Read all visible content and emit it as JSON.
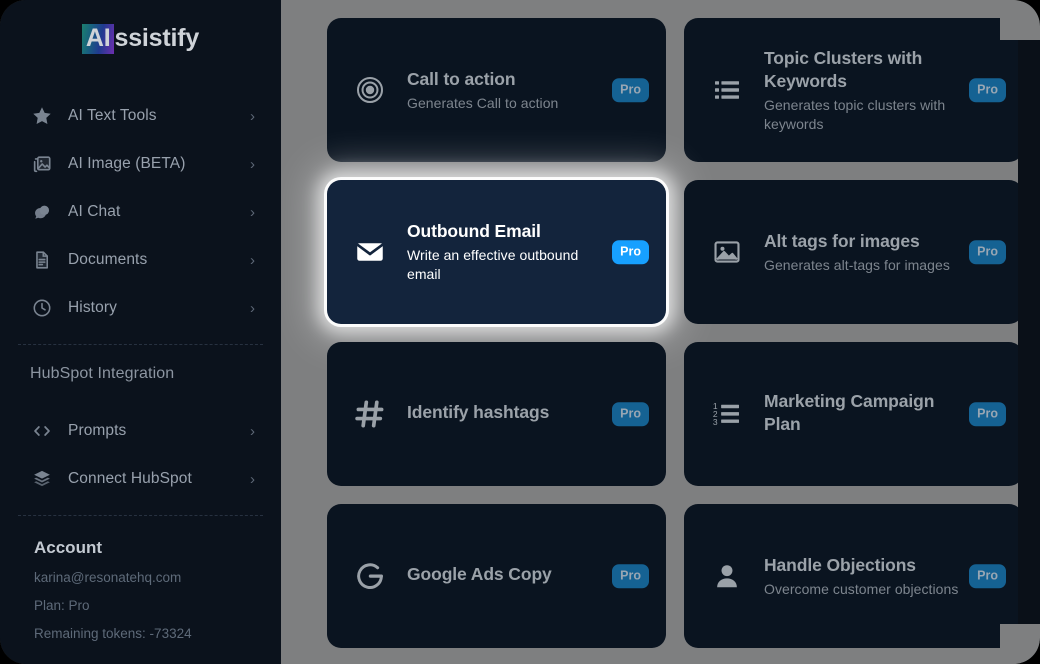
{
  "brand": {
    "logo_accent": "AI",
    "logo_rest": "ssistify",
    "gradient_from": "#1c7f6e",
    "gradient_to": "#6d2fb0"
  },
  "sidebar": {
    "nav_items": [
      {
        "label": "AI Text Tools",
        "icon": "star-icon",
        "chevron": "›"
      },
      {
        "label": "AI Image (BETA)",
        "icon": "image-stack-icon",
        "chevron": "›"
      },
      {
        "label": "AI Chat",
        "icon": "chat-bubble-icon",
        "chevron": "›"
      },
      {
        "label": "Documents",
        "icon": "document-icon",
        "chevron": "›"
      },
      {
        "label": "History",
        "icon": "clock-icon",
        "chevron": "›"
      }
    ],
    "integration_title": "HubSpot Integration",
    "integration_items": [
      {
        "label": "Prompts",
        "icon": "code-brackets-icon",
        "chevron": "›"
      },
      {
        "label": "Connect HubSpot",
        "icon": "layers-icon",
        "chevron": "›"
      }
    ],
    "account_title": "Account",
    "account_email": "karina@resonatehq.com",
    "account_plan": "Plan: Pro",
    "account_tokens": "Remaining tokens: -73324"
  },
  "main": {
    "badge_label": "Pro",
    "cards": [
      {
        "title": "Call to action",
        "desc": "Generates Call to action",
        "icon": "target-icon",
        "selected": false
      },
      {
        "title": "Topic Clusters with Keywords",
        "desc": "Generates topic clusters with keywords",
        "icon": "bullet-list-icon",
        "selected": false
      },
      {
        "title": "Outbound Email",
        "desc": "Write an effective outbound email",
        "icon": "envelope-icon",
        "selected": true
      },
      {
        "title": "Alt tags for images",
        "desc": "Generates alt-tags for images",
        "icon": "picture-icon",
        "selected": false
      },
      {
        "title": "Identify hashtags",
        "desc": "",
        "icon": "hashtag-icon",
        "selected": false
      },
      {
        "title": "Marketing Campaign Plan",
        "desc": "",
        "icon": "numbered-list-icon",
        "selected": false
      },
      {
        "title": "Google Ads Copy",
        "desc": "",
        "icon": "google-g-icon",
        "selected": false
      },
      {
        "title": "Handle Objections",
        "desc": "Overcome customer objections",
        "icon": "person-icon",
        "selected": false
      }
    ]
  },
  "colors": {
    "sidebar_bg": "#0b121c",
    "card_bg": "#0a1420",
    "card_selected_bg": "#13243c",
    "content_bg": "#7e7f80",
    "badge": "#156293",
    "badge_selected": "#17a0ff"
  }
}
